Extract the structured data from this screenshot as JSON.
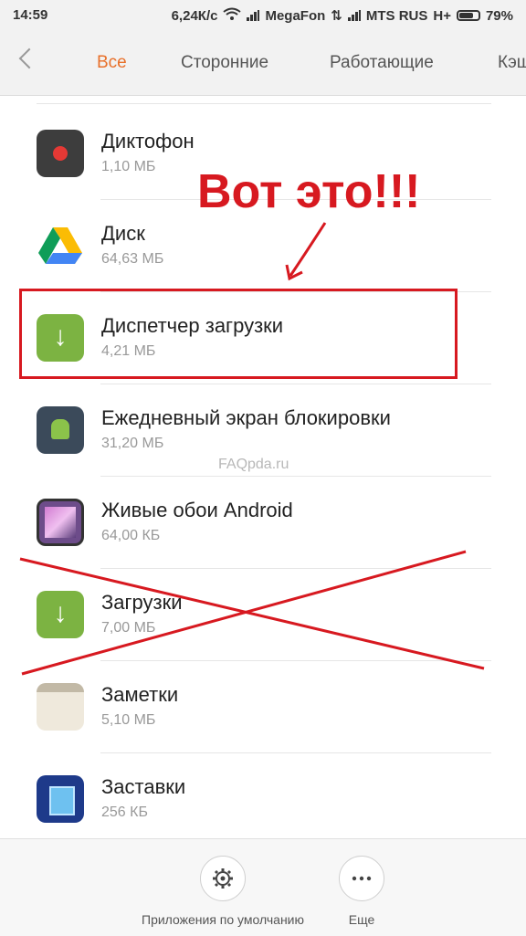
{
  "status_bar": {
    "time": "14:59",
    "speed": "6,24К/с",
    "carrier1": "MegaFon",
    "carrier2": "MTS RUS",
    "network2": "H+",
    "battery": "79%"
  },
  "tabs": [
    {
      "label": "Все",
      "active": true
    },
    {
      "label": "Сторонние",
      "active": false
    },
    {
      "label": "Работающие",
      "active": false
    },
    {
      "label": "Кэш",
      "active": false
    }
  ],
  "apps": [
    {
      "name": "Диктофон",
      "size": "1,10 МБ",
      "icon": "recorder-icon"
    },
    {
      "name": "Диск",
      "size": "64,63 МБ",
      "icon": "drive-icon"
    },
    {
      "name": "Диспетчер загрузки",
      "size": "4,21 МБ",
      "icon": "download-icon"
    },
    {
      "name": "Ежедневный экран блокировки",
      "size": "31,20 МБ",
      "icon": "android-icon"
    },
    {
      "name": "Живые обои Android",
      "size": "64,00 КБ",
      "icon": "wallpaper-icon"
    },
    {
      "name": "Загрузки",
      "size": "7,00 МБ",
      "icon": "download-icon"
    },
    {
      "name": "Заметки",
      "size": "5,10 МБ",
      "icon": "notes-icon"
    },
    {
      "name": "Заставки",
      "size": "256 КБ",
      "icon": "screensaver-icon"
    }
  ],
  "annotation": {
    "title": "Вот это!!!",
    "color": "#d71920"
  },
  "watermark": "FAQpda.ru",
  "bottom_bar": {
    "default_apps_label": "Приложения по умолчанию",
    "more_label": "Еще"
  },
  "colors": {
    "accent": "#e8702a",
    "annotation": "#d71920"
  }
}
